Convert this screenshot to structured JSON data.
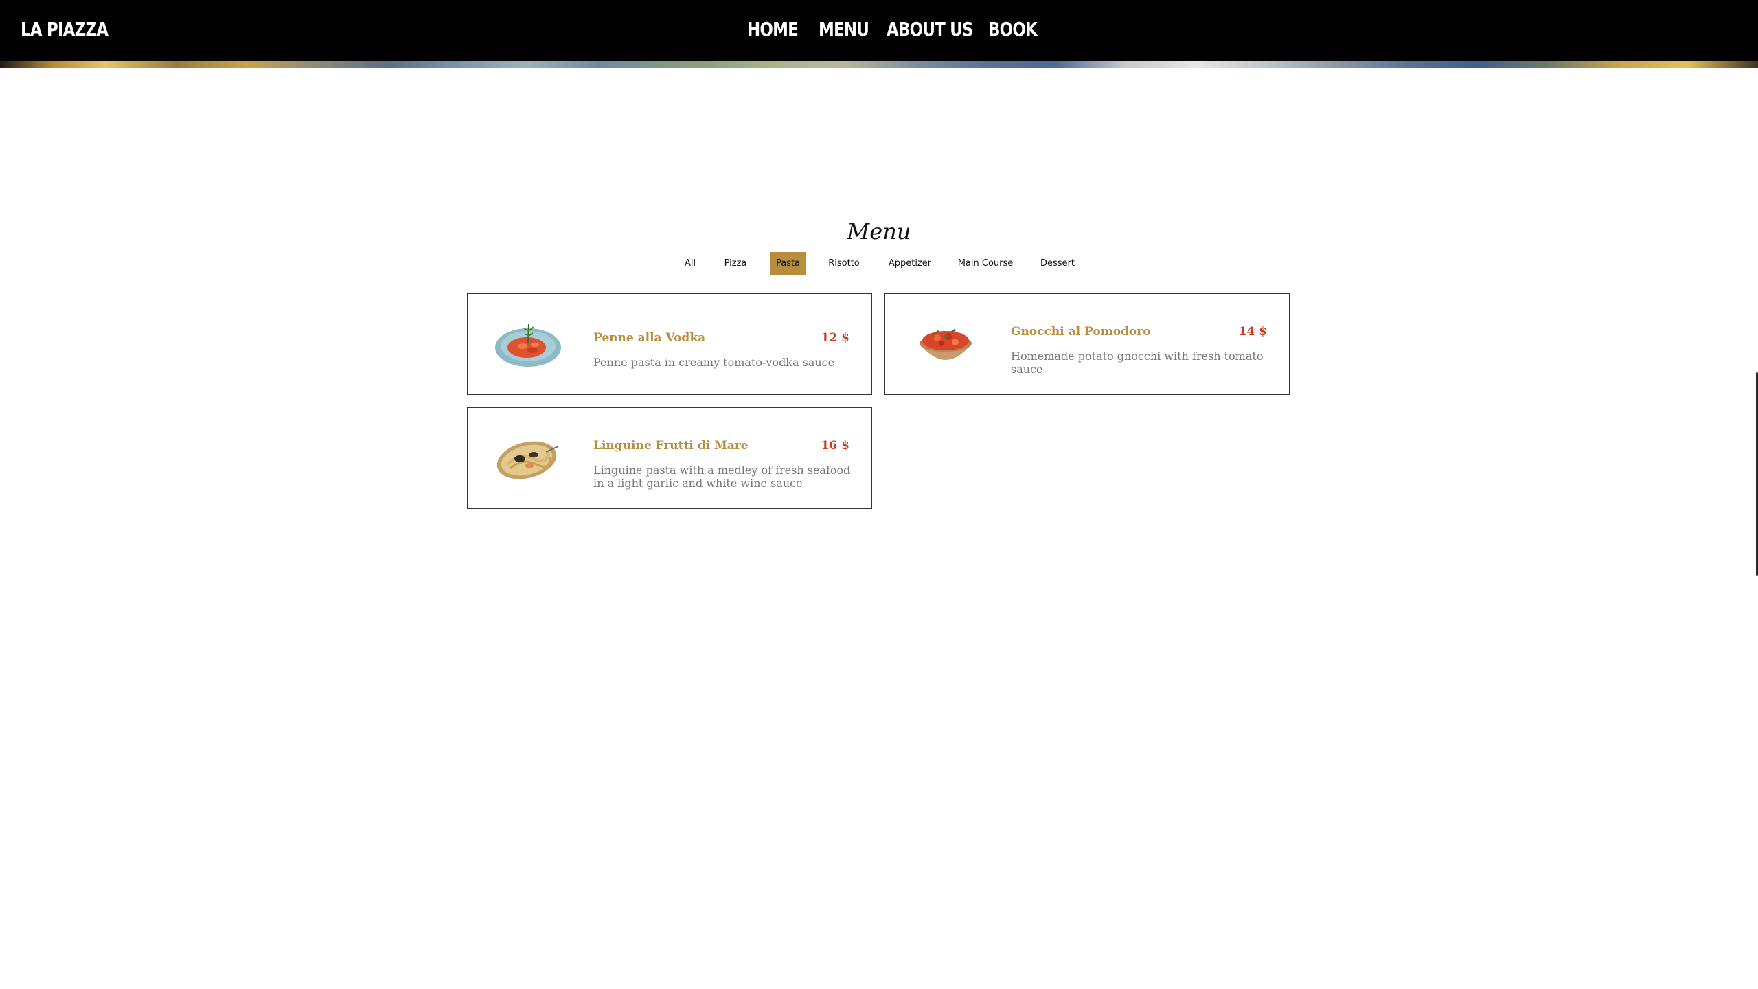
{
  "header": {
    "brand": "LA PIAZZA",
    "nav": [
      "HOME",
      "MENU",
      "ABOUT US",
      "BOOK"
    ]
  },
  "menu": {
    "title": "Menu",
    "filters": [
      "All",
      "Pizza",
      "Pasta",
      "Risotto",
      "Appetizer",
      "Main Course",
      "Dessert"
    ],
    "active_filter": "Pasta",
    "items": [
      {
        "name": "Penne alla Vodka",
        "price": "12 $",
        "description": "Penne pasta in creamy tomato-vodka sauce",
        "image": "penne-plate-icon"
      },
      {
        "name": "Gnocchi al Pomodoro",
        "price": "14 $",
        "description": "Homemade potato gnocchi with fresh tomato sauce",
        "image": "gnocchi-bowl-icon"
      },
      {
        "name": "Linguine Frutti di Mare",
        "price": "16 $",
        "description": "Linguine pasta with a medley of fresh seafood in a light garlic and white wine sauce",
        "image": "seafood-linguine-icon"
      }
    ]
  },
  "colors": {
    "accent": "#b88d3e",
    "price": "#cc3a1e",
    "navbar": "#000000"
  }
}
